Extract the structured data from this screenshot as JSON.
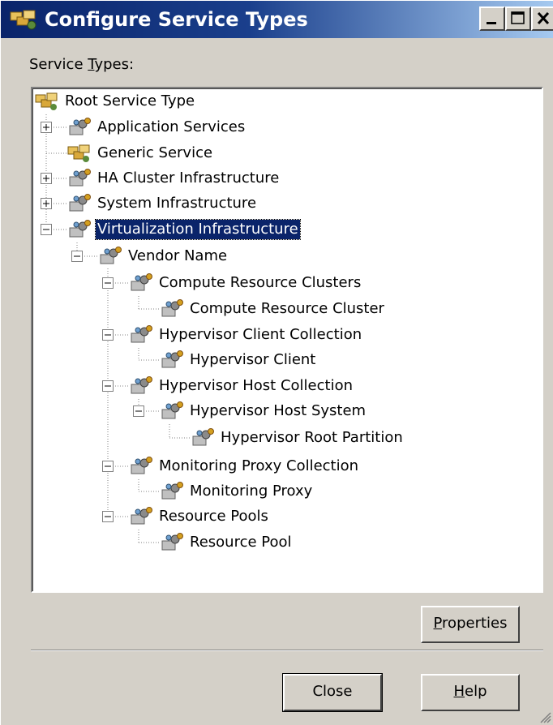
{
  "window": {
    "title": "Configure Service Types"
  },
  "labels": {
    "service_types_pre": "Service ",
    "service_types_u": "T",
    "service_types_post": "ypes:"
  },
  "tree": [
    {
      "label": "Root Service Type"
    },
    {
      "label": "Application Services"
    },
    {
      "label": "Generic Service"
    },
    {
      "label": "HA Cluster Infrastructure"
    },
    {
      "label": "System Infrastructure"
    },
    {
      "label": "Virtualization Infrastructure"
    },
    {
      "label": "Vendor Name"
    },
    {
      "label": "Compute Resource Clusters"
    },
    {
      "label": "Compute Resource Cluster"
    },
    {
      "label": "Hypervisor Client Collection"
    },
    {
      "label": "Hypervisor Client"
    },
    {
      "label": "Hypervisor Host Collection"
    },
    {
      "label": "Hypervisor Host System"
    },
    {
      "label": "Hypervisor Root Partition"
    },
    {
      "label": "Monitoring Proxy Collection"
    },
    {
      "label": "Monitoring Proxy"
    },
    {
      "label": "Resource Pools"
    },
    {
      "label": "Resource Pool"
    }
  ],
  "buttons": {
    "properties_u": "P",
    "properties_rest": "roperties",
    "close": "Close",
    "help_u": "H",
    "help_rest": "elp"
  }
}
